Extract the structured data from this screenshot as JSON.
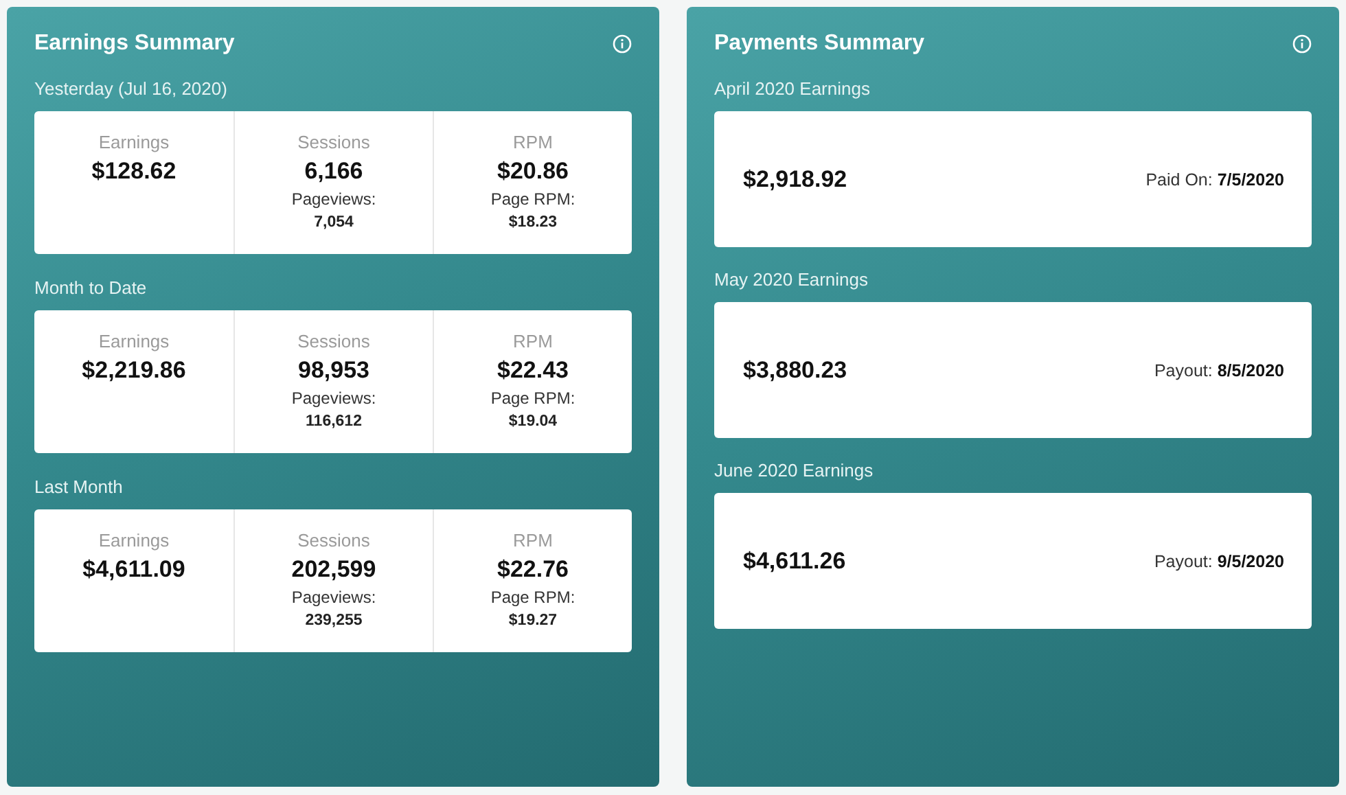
{
  "earnings_summary": {
    "title": "Earnings Summary",
    "sections": [
      {
        "label": "Yesterday (Jul 16, 2020)",
        "metrics": [
          {
            "label": "Earnings",
            "value": "$128.62"
          },
          {
            "label": "Sessions",
            "value": "6,166",
            "sub_label": "Pageviews:",
            "sub_value": "7,054"
          },
          {
            "label": "RPM",
            "value": "$20.86",
            "sub_label": "Page RPM:",
            "sub_value": "$18.23"
          }
        ]
      },
      {
        "label": "Month to Date",
        "metrics": [
          {
            "label": "Earnings",
            "value": "$2,219.86"
          },
          {
            "label": "Sessions",
            "value": "98,953",
            "sub_label": "Pageviews:",
            "sub_value": "116,612"
          },
          {
            "label": "RPM",
            "value": "$22.43",
            "sub_label": "Page RPM:",
            "sub_value": "$19.04"
          }
        ]
      },
      {
        "label": "Last Month",
        "metrics": [
          {
            "label": "Earnings",
            "value": "$4,611.09"
          },
          {
            "label": "Sessions",
            "value": "202,599",
            "sub_label": "Pageviews:",
            "sub_value": "239,255"
          },
          {
            "label": "RPM",
            "value": "$22.76",
            "sub_label": "Page RPM:",
            "sub_value": "$19.27"
          }
        ]
      }
    ]
  },
  "payments_summary": {
    "title": "Payments Summary",
    "items": [
      {
        "label": "April 2020 Earnings",
        "amount": "$2,918.92",
        "date_label": "Paid On:",
        "date": "7/5/2020"
      },
      {
        "label": "May 2020 Earnings",
        "amount": "$3,880.23",
        "date_label": "Payout:",
        "date": "8/5/2020"
      },
      {
        "label": "June 2020 Earnings",
        "amount": "$4,611.26",
        "date_label": "Payout:",
        "date": "9/5/2020"
      }
    ]
  }
}
